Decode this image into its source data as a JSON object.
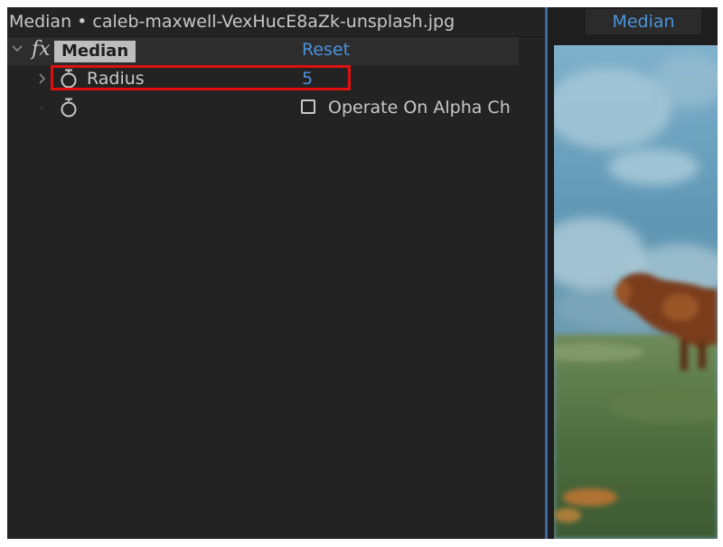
{
  "effect_controls": {
    "title": "Median • caleb-maxwell-VexHucE8aZk-unsplash.jpg",
    "effect": {
      "fx_label": "fx",
      "name": "Median",
      "reset_label": "Reset"
    },
    "properties": [
      {
        "label": "Radius",
        "value": "5",
        "highlighted": true
      },
      {
        "label": "Operate On Alpha Ch",
        "checked": false
      }
    ]
  },
  "composition": {
    "tab_label": "Median",
    "preview": "blurred-horse-in-field"
  },
  "colors": {
    "panel_bg": "#232323",
    "accent_blue": "#4c93dc",
    "highlight_red": "#e01010",
    "effect_name_bg": "#bdbdbd"
  }
}
